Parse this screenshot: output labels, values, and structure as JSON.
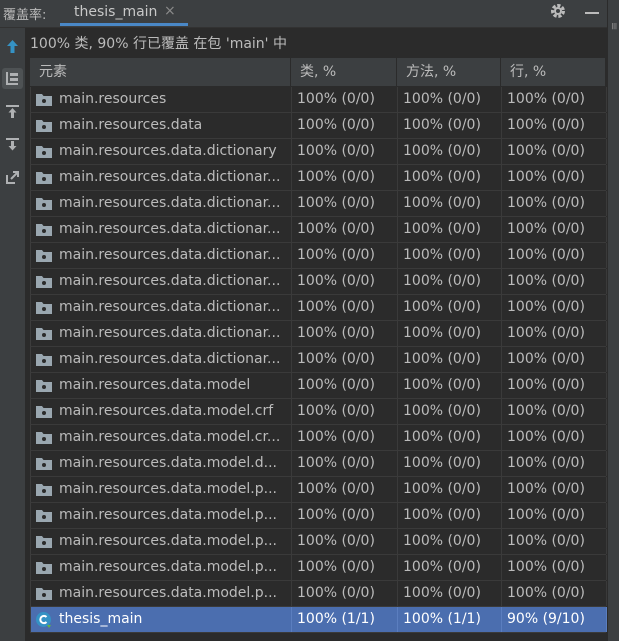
{
  "header": {
    "title": "覆盖率:",
    "tab_label": "thesis_main",
    "tab_close": "×"
  },
  "summary": "100% 类, 90% 行已覆盖 在包 'main' 中",
  "table": {
    "columns": [
      "元素",
      "类, %",
      "方法, %",
      "行, %"
    ],
    "rows": [
      {
        "name": "main.resources",
        "cls": "100% (0/0)",
        "method": "100% (0/0)",
        "line": "100% (0/0)"
      },
      {
        "name": "main.resources.data",
        "cls": "100% (0/0)",
        "method": "100% (0/0)",
        "line": "100% (0/0)"
      },
      {
        "name": "main.resources.data.dictionary",
        "cls": "100% (0/0)",
        "method": "100% (0/0)",
        "line": "100% (0/0)"
      },
      {
        "name": "main.resources.data.dictionar...",
        "cls": "100% (0/0)",
        "method": "100% (0/0)",
        "line": "100% (0/0)"
      },
      {
        "name": "main.resources.data.dictionar...",
        "cls": "100% (0/0)",
        "method": "100% (0/0)",
        "line": "100% (0/0)"
      },
      {
        "name": "main.resources.data.dictionar...",
        "cls": "100% (0/0)",
        "method": "100% (0/0)",
        "line": "100% (0/0)"
      },
      {
        "name": "main.resources.data.dictionar...",
        "cls": "100% (0/0)",
        "method": "100% (0/0)",
        "line": "100% (0/0)"
      },
      {
        "name": "main.resources.data.dictionar...",
        "cls": "100% (0/0)",
        "method": "100% (0/0)",
        "line": "100% (0/0)"
      },
      {
        "name": "main.resources.data.dictionar...",
        "cls": "100% (0/0)",
        "method": "100% (0/0)",
        "line": "100% (0/0)"
      },
      {
        "name": "main.resources.data.dictionar...",
        "cls": "100% (0/0)",
        "method": "100% (0/0)",
        "line": "100% (0/0)"
      },
      {
        "name": "main.resources.data.dictionar...",
        "cls": "100% (0/0)",
        "method": "100% (0/0)",
        "line": "100% (0/0)"
      },
      {
        "name": "main.resources.data.model",
        "cls": "100% (0/0)",
        "method": "100% (0/0)",
        "line": "100% (0/0)"
      },
      {
        "name": "main.resources.data.model.crf",
        "cls": "100% (0/0)",
        "method": "100% (0/0)",
        "line": "100% (0/0)"
      },
      {
        "name": "main.resources.data.model.cr...",
        "cls": "100% (0/0)",
        "method": "100% (0/0)",
        "line": "100% (0/0)"
      },
      {
        "name": "main.resources.data.model.d...",
        "cls": "100% (0/0)",
        "method": "100% (0/0)",
        "line": "100% (0/0)"
      },
      {
        "name": "main.resources.data.model.p...",
        "cls": "100% (0/0)",
        "method": "100% (0/0)",
        "line": "100% (0/0)"
      },
      {
        "name": "main.resources.data.model.p...",
        "cls": "100% (0/0)",
        "method": "100% (0/0)",
        "line": "100% (0/0)"
      },
      {
        "name": "main.resources.data.model.p...",
        "cls": "100% (0/0)",
        "method": "100% (0/0)",
        "line": "100% (0/0)"
      },
      {
        "name": "main.resources.data.model.p...",
        "cls": "100% (0/0)",
        "method": "100% (0/0)",
        "line": "100% (0/0)"
      },
      {
        "name": "main.resources.data.model.p...",
        "cls": "100% (0/0)",
        "method": "100% (0/0)",
        "line": "100% (0/0)"
      },
      {
        "name": "thesis_main",
        "cls": "100% (1/1)",
        "method": "100% (1/1)",
        "line": "90% (9/10)",
        "selected": true,
        "icon": "class-icon"
      }
    ]
  },
  "toolbar": {
    "icons": [
      "arrow-up-icon",
      "flatten-packages-icon",
      "import-icon",
      "export-icon",
      "open-external-icon"
    ]
  },
  "colors": {
    "background": "#2b2b2b",
    "panel": "#3c3f41",
    "selection": "#4b6eaf",
    "accent": "#4a88c7"
  }
}
